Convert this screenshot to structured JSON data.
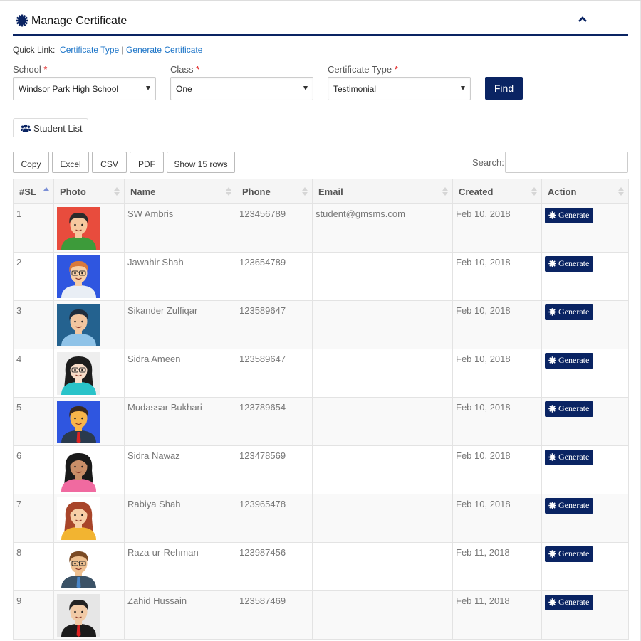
{
  "header": {
    "title": "Manage Certificate"
  },
  "quick_link": {
    "label": "Quick Link:",
    "links": [
      "Certificate Type",
      "Generate Certificate"
    ],
    "separator": "|"
  },
  "filters": {
    "school": {
      "label": "School",
      "value": "Windsor Park High School"
    },
    "class": {
      "label": "Class",
      "value": "One"
    },
    "certificate_type": {
      "label": "Certificate Type",
      "value": "Testimonial"
    },
    "required_mark": "*",
    "find_label": "Find"
  },
  "tab": {
    "label": "Student List"
  },
  "toolbar": {
    "buttons": [
      "Copy",
      "Excel",
      "CSV",
      "PDF",
      "Show 15 rows"
    ],
    "search_label": "Search:"
  },
  "table": {
    "columns": [
      "#SL",
      "Photo",
      "Name",
      "Phone",
      "Email",
      "Created",
      "Action"
    ],
    "action_label": "Generate",
    "rows": [
      {
        "sl": "1",
        "name": "SW Ambris",
        "phone": "123456789",
        "email": "student@gmsms.com",
        "created": "Feb 10, 2018",
        "avatar": "boy-icon"
      },
      {
        "sl": "2",
        "name": "Jawahir Shah",
        "phone": "123654789",
        "email": "",
        "created": "Feb 10, 2018",
        "avatar": "boy-glasses-icon"
      },
      {
        "sl": "3",
        "name": "Sikander Zulfiqar",
        "phone": "123589647",
        "email": "",
        "created": "Feb 10, 2018",
        "avatar": "man-icon"
      },
      {
        "sl": "4",
        "name": "Sidra Ameen",
        "phone": "123589647",
        "email": "",
        "created": "Feb 10, 2018",
        "avatar": "girl-glasses-icon"
      },
      {
        "sl": "5",
        "name": "Mudassar Bukhari",
        "phone": "123789654",
        "email": "",
        "created": "Feb 10, 2018",
        "avatar": "man-tie-icon"
      },
      {
        "sl": "6",
        "name": "Sidra Nawaz",
        "phone": "123478569",
        "email": "",
        "created": "Feb 10, 2018",
        "avatar": "girl-icon"
      },
      {
        "sl": "7",
        "name": "Rabiya Shah",
        "phone": "123965478",
        "email": "",
        "created": "Feb 10, 2018",
        "avatar": "girl-smile-icon"
      },
      {
        "sl": "8",
        "name": "Raza-ur-Rehman",
        "phone": "123987456",
        "email": "",
        "created": "Feb 11, 2018",
        "avatar": "man-glasses-icon"
      },
      {
        "sl": "9",
        "name": "Zahid Hussain",
        "phone": "123587469",
        "email": "",
        "created": "Feb 11, 2018",
        "avatar": "man-suit-icon"
      }
    ]
  },
  "colors": {
    "primary": "#0a2463",
    "link": "#1a73c7",
    "required": "#dd0000"
  }
}
